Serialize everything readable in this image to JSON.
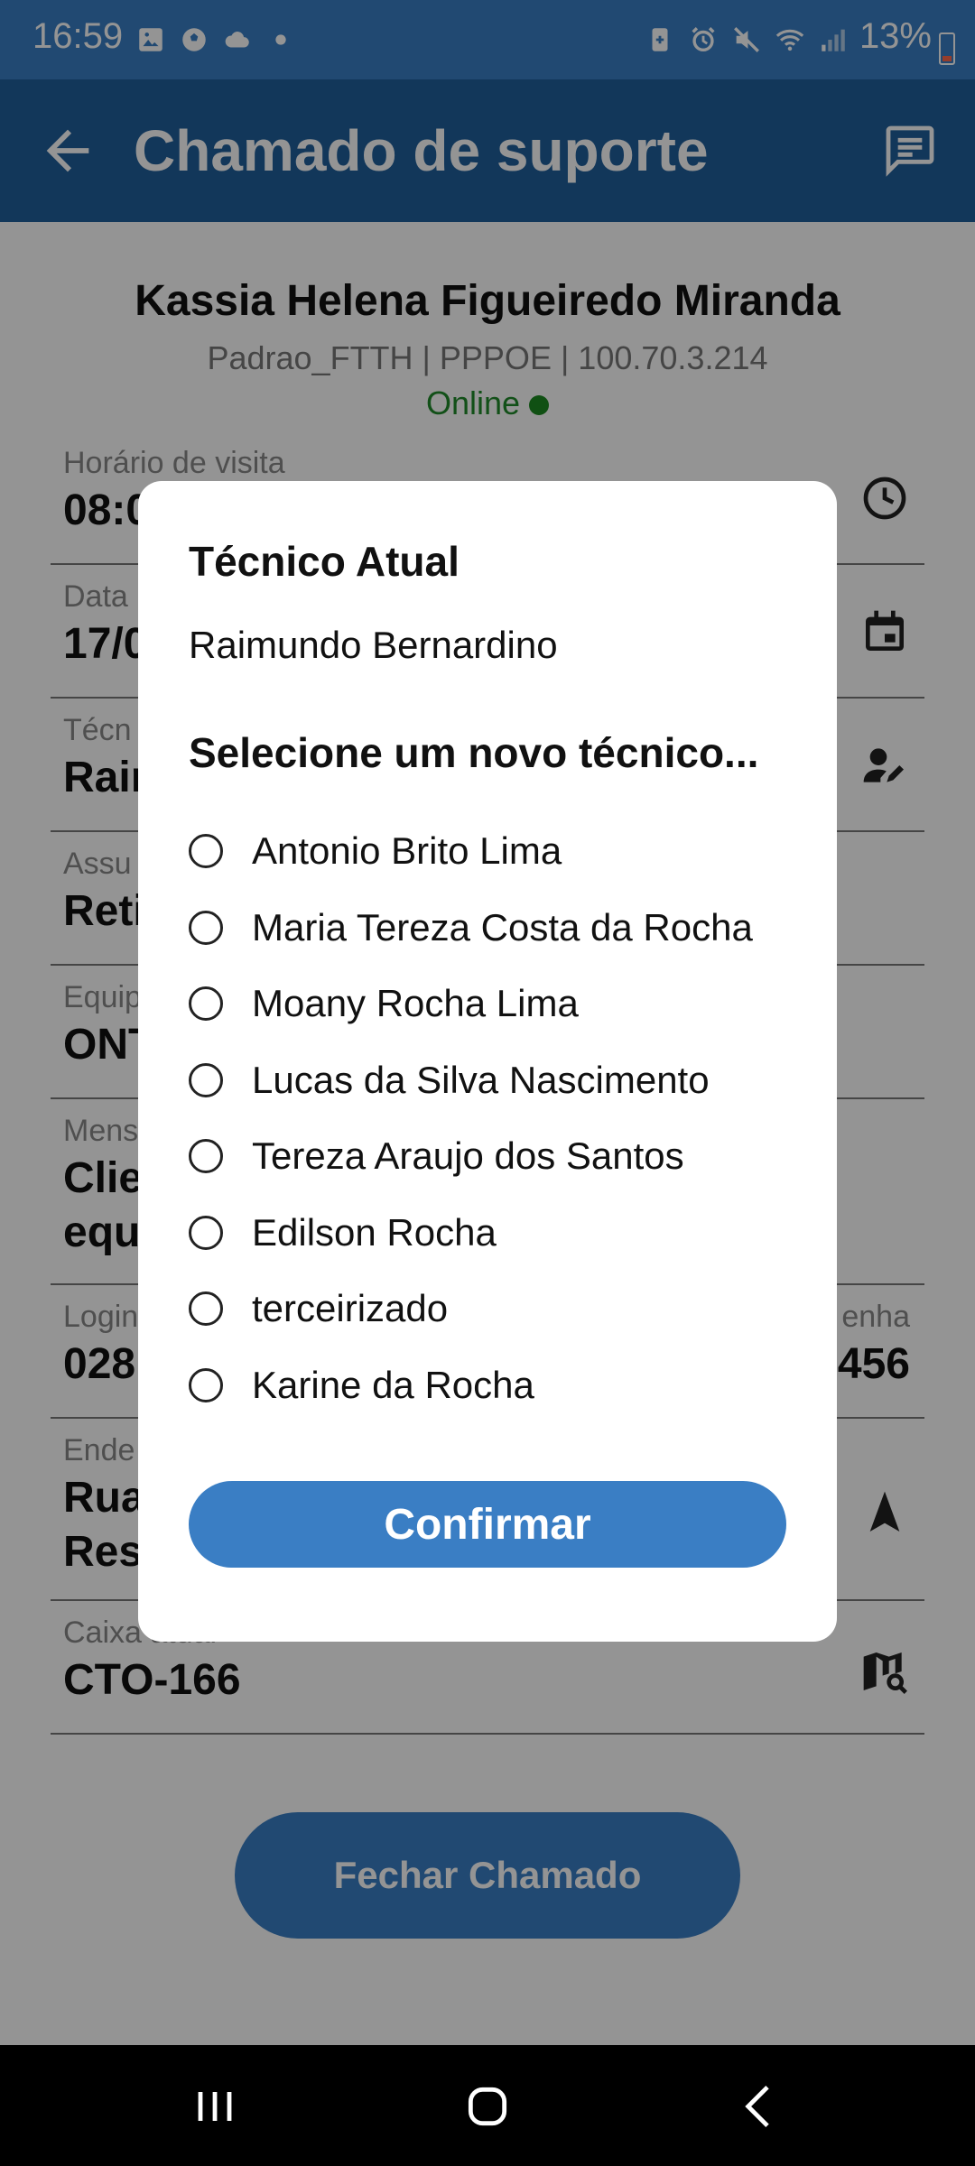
{
  "status_bar": {
    "time": "16:59",
    "battery": "13%",
    "icons_left": [
      "image-icon",
      "soccer-ball-icon",
      "cloud-icon",
      "dot-icon"
    ],
    "icons_right": [
      "battery-saver-icon",
      "alarm-icon",
      "mute-icon",
      "wifi-icon",
      "signal-icon"
    ]
  },
  "app_bar": {
    "title": "Chamado de suporte",
    "back_icon": "arrow-back-icon",
    "action_icon": "chat-icon"
  },
  "customer": {
    "name": "Kassia Helena Figueiredo Miranda",
    "plan": "Padrao_FTTH | PPPOE | 100.70.3.214",
    "status": "Online"
  },
  "fields": [
    {
      "label": "Horário de visita",
      "value": "08:0"
    },
    {
      "label": "Data",
      "value": "17/0"
    },
    {
      "label": "Técn",
      "value": "Rair"
    },
    {
      "label": "Assu",
      "value": "Reti"
    },
    {
      "label": "Equip",
      "value": "ONT"
    },
    {
      "label": "Mens",
      "value": "Clie",
      "value2": "equ"
    },
    {
      "label": "Login",
      "value": "028",
      "label_right": "enha",
      "value_right": "456"
    },
    {
      "label": "Ende",
      "value": "Rua",
      "value2": "Res"
    },
    {
      "label": "Caixa atual",
      "value": "CTO-166"
    }
  ],
  "close_button": "Fechar Chamado",
  "dialog": {
    "current_heading": "Técnico Atual",
    "current_name": "Raimundo Bernardino",
    "select_heading": "Selecione um novo técnico...",
    "options": [
      "Antonio Brito Lima",
      "Maria Tereza Costa da Rocha",
      "Moany Rocha Lima",
      "Lucas da Silva Nascimento",
      "Tereza Araujo dos Santos",
      "Edilson Rocha",
      "terceirizado",
      "Karine da Rocha"
    ],
    "confirm": "Confirmar"
  },
  "colors": {
    "primary": "#3a7ec4",
    "app_bar": "#1f5f9c",
    "online": "#208a2a"
  }
}
